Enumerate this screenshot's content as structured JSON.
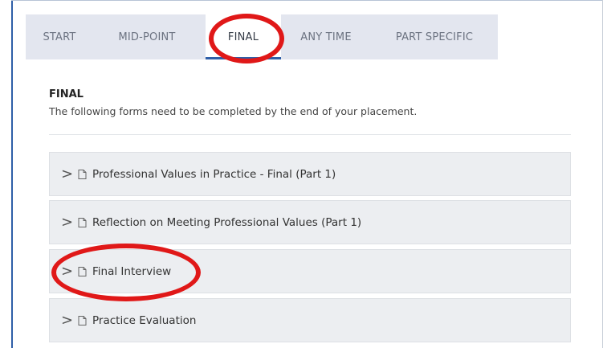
{
  "tabs": [
    {
      "label": "START",
      "active": false
    },
    {
      "label": "MID-POINT",
      "active": false
    },
    {
      "label": "FINAL",
      "active": true
    },
    {
      "label": "ANY TIME",
      "active": false
    },
    {
      "label": "PART SPECIFIC",
      "active": false
    }
  ],
  "section": {
    "title": "FINAL",
    "description": "The following forms need to be completed by the end of your placement."
  },
  "forms": [
    {
      "label": "Professional Values in Practice - Final (Part 1)",
      "icon": "document-icon"
    },
    {
      "label": "Reflection on Meeting Professional Values (Part 1)",
      "icon": "document-icon"
    },
    {
      "label": "Final Interview",
      "icon": "document-icon"
    },
    {
      "label": "Practice Evaluation",
      "icon": "document-icon"
    }
  ],
  "colors": {
    "accent": "#2f5fa8",
    "tab_bar_bg": "#e3e6ef",
    "annotation_red": "#e01818",
    "form_item_bg": "#eceef1"
  }
}
